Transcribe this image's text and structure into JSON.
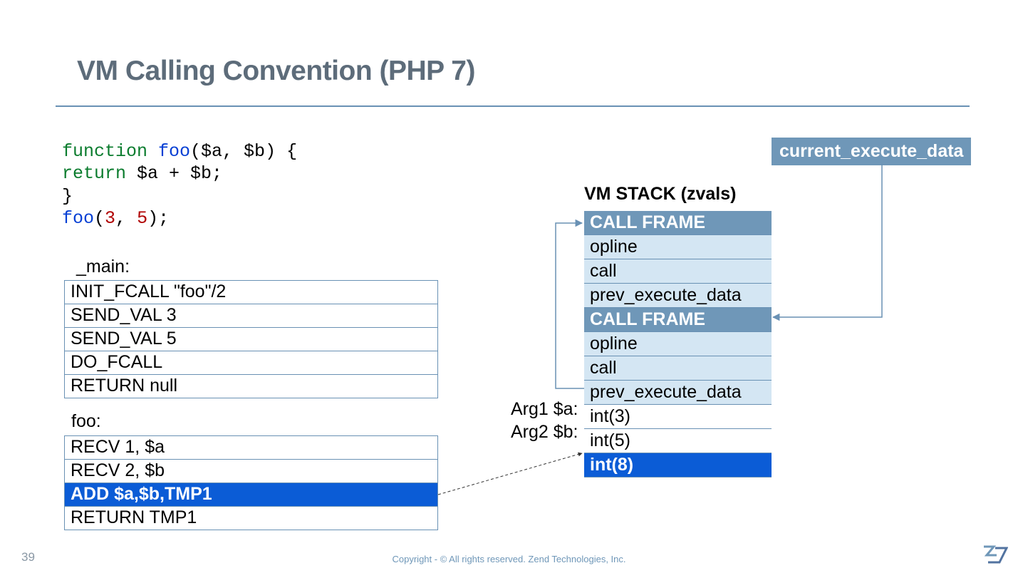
{
  "title": "VM Calling Convention (PHP 7)",
  "code": {
    "l1a": "function",
    "l1b": " foo",
    "l1c": "($a, $b) {",
    "l2a": "    return",
    "l2b": " $a + $b;",
    "l3": "}",
    "l4a": "foo",
    "l4b": "(",
    "l4c": "3",
    "l4d": ", ",
    "l4e": "5",
    "l4f": ");"
  },
  "sections": {
    "main_label": "_main:",
    "main_ops": [
      "INIT_FCALL  \"foo\"/2",
      "SEND_VAL 3",
      "SEND_VAL 5",
      "DO_FCALL",
      "RETURN null"
    ],
    "foo_label": "foo:",
    "foo_ops": [
      "RECV 1, $a",
      "RECV 2, $b",
      "ADD $a,$b,TMP1",
      "RETURN TMP1"
    ],
    "foo_highlight_index": 2
  },
  "stack": {
    "title": "VM STACK (zvals)",
    "rows": [
      {
        "text": "CALL FRAME",
        "type": "header"
      },
      {
        "text": "opline",
        "type": "cell"
      },
      {
        "text": "call",
        "type": "cell"
      },
      {
        "text": "prev_execute_data",
        "type": "cell"
      },
      {
        "text": "CALL FRAME",
        "type": "header"
      },
      {
        "text": "opline",
        "type": "cell"
      },
      {
        "text": "call",
        "type": "cell"
      },
      {
        "text": "prev_execute_data",
        "type": "cell"
      },
      {
        "text": "int(3)",
        "type": "val"
      },
      {
        "text": "int(5)",
        "type": "val"
      },
      {
        "text": "int(8)",
        "type": "result"
      }
    ],
    "arg1": "Arg1 $a:",
    "arg2": "Arg2 $b:"
  },
  "pointer": {
    "label": "current_execute_data"
  },
  "footer": {
    "page": "39",
    "copyright": "Copyright - © All rights reserved. Zend Technologies, Inc."
  }
}
